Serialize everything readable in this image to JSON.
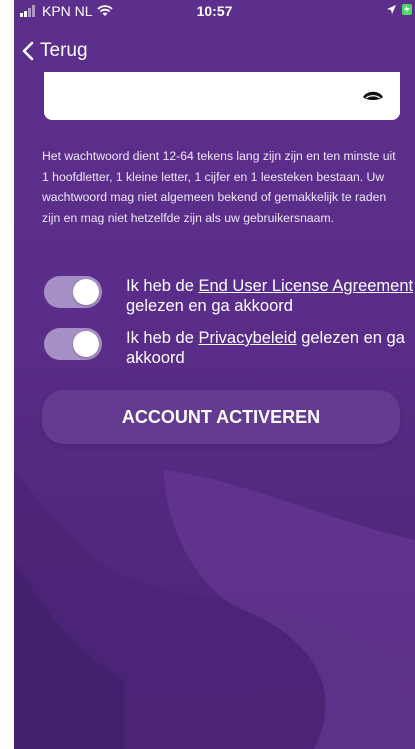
{
  "status_bar": {
    "carrier": "KPN NL",
    "time": "10:57"
  },
  "nav": {
    "back_label": "Terug"
  },
  "password_field": {
    "icon": "eye-icon"
  },
  "info_text": "Het wachtwoord dient 12-64 tekens lang zijn zijn en ten minste uit 1 hoofdletter, 1 kleine letter, 1 cijfer en 1 leesteken bestaan. Uw wachtwoord mag niet algemeen bekend of gemakkelijk te raden zijn en mag niet hetzelfde zijn als uw gebruikersnaam.",
  "toggles": [
    {
      "before": "Ik heb de ",
      "link": "End User License Agreement",
      "after": " gelezen en ga akkoord",
      "on": true
    },
    {
      "before": "Ik heb de ",
      "link": "Privacybeleid",
      "after": " gelezen en ga akkoord",
      "on": true
    }
  ],
  "activate_button": "ACCOUNT ACTIVEREN",
  "colors": {
    "background": "#5d2f8c",
    "toggle_on": "#a58fc4",
    "battery": "#4cd964"
  }
}
